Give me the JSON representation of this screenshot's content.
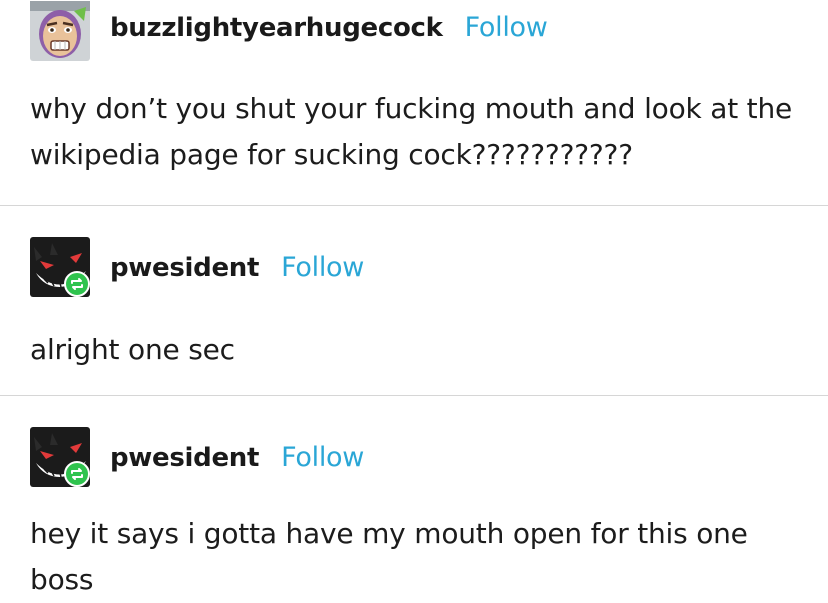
{
  "posts": [
    {
      "username": "buzzlightyearhugecock",
      "follow_label": "Follow",
      "text": "why don’t you shut your fucking mouth and look at the wikipedia page for sucking cock???????????",
      "reblog": false
    },
    {
      "username": "pwesident",
      "follow_label": "Follow",
      "text": "alright one sec",
      "reblog": true
    },
    {
      "username": "pwesident",
      "follow_label": "Follow",
      "text": "hey it says i gotta have my mouth open for this one boss",
      "reblog": true
    }
  ],
  "colors": {
    "follow": "#2aa6d6",
    "reblog_badge": "#2fc34e",
    "divider": "#d6d6d6"
  },
  "icons": {
    "avatar_1": "buzz-lightyear-avatar",
    "avatar_2": "gengar-avatar",
    "avatar_3": "gengar-avatar",
    "reblog": "reblog-icon"
  }
}
